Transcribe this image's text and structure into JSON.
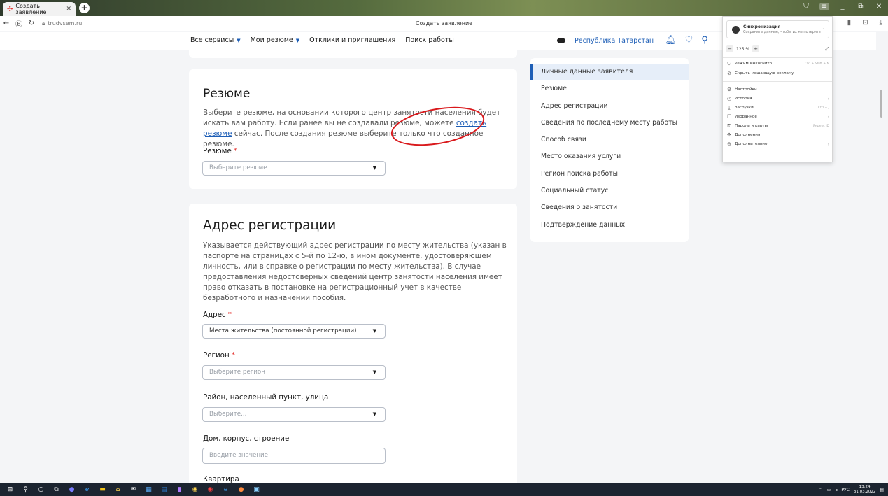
{
  "browser": {
    "tab_title": "Создать заявление",
    "url": "trudvsem.ru",
    "page_title": "Создать заявление",
    "menu": {
      "sync_title": "Синхронизация",
      "sync_sub": "Сохраните данные, чтобы их не потерять",
      "zoom": "125 %",
      "zoom_minus": "−",
      "zoom_plus": "+",
      "items": [
        {
          "label": "Режим Инкогнито",
          "shortcut": "Ctrl + Shift + N",
          "icon": "incognito-icon"
        },
        {
          "label": "Скрыть мешающую рекламу",
          "icon": "block-icon"
        },
        {
          "label": "Настройки",
          "icon": "gear-icon"
        },
        {
          "label": "История",
          "icon": "clock-icon"
        },
        {
          "label": "Загрузки",
          "shortcut": "Ctrl + J",
          "icon": "download-icon"
        },
        {
          "label": "Избранное",
          "icon": "bookmark-icon"
        },
        {
          "label": "Пароли и карты",
          "shortcut": "Яндекс ID",
          "icon": "key-icon"
        },
        {
          "label": "Дополнения",
          "icon": "puzzle-icon"
        },
        {
          "label": "Дополнительно",
          "icon": "more-icon"
        }
      ]
    }
  },
  "header": {
    "nav": {
      "all_services": "Все сервисы",
      "my_resumes": "Мои резюме",
      "responses": "Отклики и приглашения",
      "job_search": "Поиск работы"
    },
    "region": "Республика Татарстан"
  },
  "resume": {
    "title": "Резюме",
    "desc_1": "Выберите резюме, на основании которого центр занятости населения будет искать вам работу. Если ранее вы не создавали резюме, можете ",
    "desc_link": "создать резюме",
    "desc_2": " сейчас. После создания резюме выберите только что созданное резюме.",
    "field_label": "Резюме",
    "placeholder": "Выберите резюме"
  },
  "address": {
    "title": "Адрес регистрации",
    "desc": "Указывается действующий адрес регистрации по месту жительства (указан в паспорте на страницах с 5-й по 12-ю, в ином документе, удостоверяющем личность, или в справке о регистрации по месту жительства). В случае предоставления недостоверных сведений центр занятости населения имеет право отказать в постановке на регистрационный учет в качестве безработного и назначении пособия.",
    "addr_label": "Адрес",
    "addr_value": "Места жительства (постоянной регистрации)",
    "region_label": "Регион",
    "region_placeholder": "Выберите регион",
    "district_label": "Район, населенный пункт, улица",
    "district_placeholder": "Выберите...",
    "house_label": "Дом, корпус, строение",
    "house_placeholder": "Введите значение",
    "apartment_label": "Квартира"
  },
  "required_mark": "*",
  "sidenav": [
    "Личные данные заявителя",
    "Резюме",
    "Адрес регистрации",
    "Сведения по последнему месту работы",
    "Способ связи",
    "Место оказания услуги",
    "Регион поиска работы",
    "Социальный статус",
    "Сведения о занятости",
    "Подтверждение данных"
  ],
  "taskbar": {
    "lang": "РУС",
    "time": "13:24",
    "date": "31.03.2022"
  },
  "colors": {
    "accent": "#1d5eb6",
    "required": "#e53935",
    "annotation": "#d9191c"
  }
}
